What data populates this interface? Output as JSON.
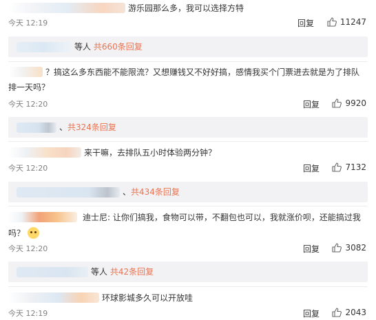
{
  "comments": [
    {
      "text": "游乐园那么多，我可以选择方特",
      "time": "今天 12:19",
      "reply": "回复",
      "likes": "11247",
      "sub_prefix": "等人",
      "sub_link": "共660条回复"
    },
    {
      "text_line1": "？搞这么多东西能不能限流？又想赚钱又不好好搞，感情我买个门票进去就是为了排队",
      "text_line2": "排一天吗？",
      "time": "今天 12:20",
      "reply": "回复",
      "likes": "9920",
      "sub_prefix": "、",
      "sub_link": "共324条回复"
    },
    {
      "text": "来干嘛，去排队五小时体验两分钟？",
      "time": "今天 12:20",
      "reply": "回复",
      "likes": "7132",
      "sub_prefix": "、",
      "sub_link": "共434条回复"
    },
    {
      "text_line1": "迪士尼: 让你们搞我，食物可以带，不翻包也可以，我就涨价呗，还能搞过我",
      "text_line2": "吗？",
      "time": "今天 12:20",
      "reply": "回复",
      "likes": "3082",
      "sub_prefix": "等人",
      "sub_link": "共42条回复"
    },
    {
      "text": "环球影城多久可以开放哇",
      "time": "今天 12:19",
      "reply": "回复",
      "likes": "2043"
    }
  ],
  "icons": {
    "like": "thumbs-up-icon",
    "emoji": "doge-emoji-icon"
  },
  "colors": {
    "link": "#eb7350",
    "subbox": "#f2f2f5",
    "time": "#808080"
  }
}
